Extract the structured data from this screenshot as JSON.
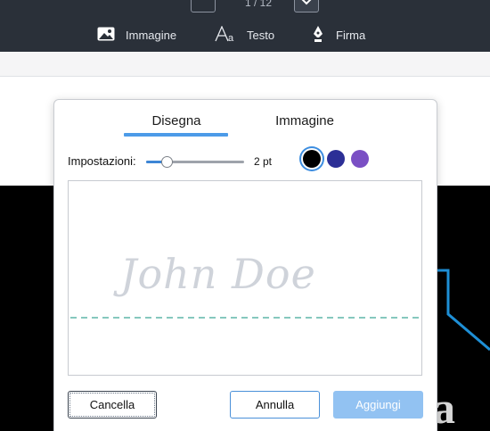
{
  "toolbar": {
    "page_indicator": "1 / 12",
    "tools": [
      {
        "label": "Immagine",
        "icon": "image-icon"
      },
      {
        "label": "Testo",
        "icon": "text-icon"
      },
      {
        "label": "Firma",
        "icon": "pen-nib-icon"
      }
    ]
  },
  "dialog": {
    "tabs": [
      {
        "label": "Disegna",
        "active": true
      },
      {
        "label": "Immagine",
        "active": false
      }
    ],
    "settings_label": "Impostazioni:",
    "pen_size_label": "2 pt",
    "pen_size_level": 0.18,
    "colors": [
      {
        "value": "#000000",
        "selected": true
      },
      {
        "value": "#2c2f96",
        "selected": false
      },
      {
        "value": "#7a4fc4",
        "selected": false
      }
    ],
    "placeholder_signature": "John Doe",
    "buttons": {
      "clear": "Cancella",
      "cancel": "Annulla",
      "add": "Aggiungi"
    }
  },
  "document": {
    "visible_letter": "a"
  }
}
